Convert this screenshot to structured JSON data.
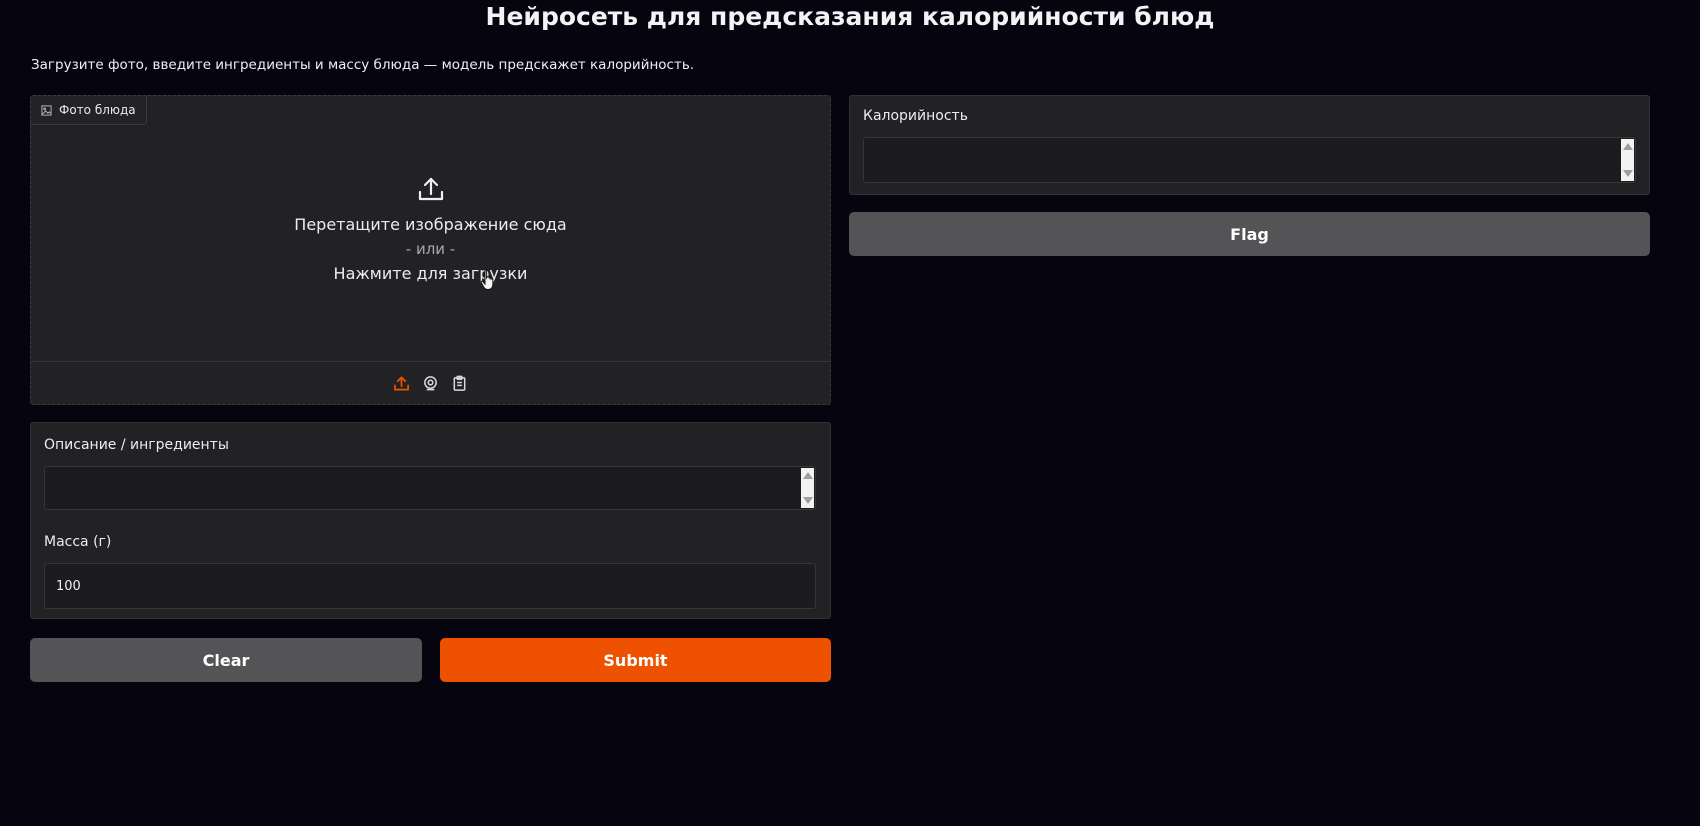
{
  "header": {
    "title": "Нейросеть для предсказания калорийности блюд",
    "description": "Загрузите фото, введите ингредиенты и массу блюда — модель предскажет калорийность."
  },
  "image_input": {
    "label": "Фото блюда",
    "label_icon": "image-icon",
    "drop_text": "Перетащите изображение сюда",
    "or_text": "- или -",
    "click_text": "Нажмите для загрузки",
    "sources": [
      {
        "name": "upload-icon",
        "active": true
      },
      {
        "name": "webcam-icon",
        "active": false
      },
      {
        "name": "clipboard-icon",
        "active": false
      }
    ]
  },
  "inputs": {
    "description_label": "Описание / ингредиенты",
    "description_value": "",
    "mass_label": "Масса (г)",
    "mass_value": "100"
  },
  "output": {
    "calories_label": "Калорийность",
    "calories_value": ""
  },
  "buttons": {
    "clear": "Clear",
    "submit": "Submit",
    "flag": "Flag"
  },
  "colors": {
    "background": "#05040f",
    "panel": "#222224",
    "accent": "#ee5200",
    "secondary_button": "#545456"
  }
}
